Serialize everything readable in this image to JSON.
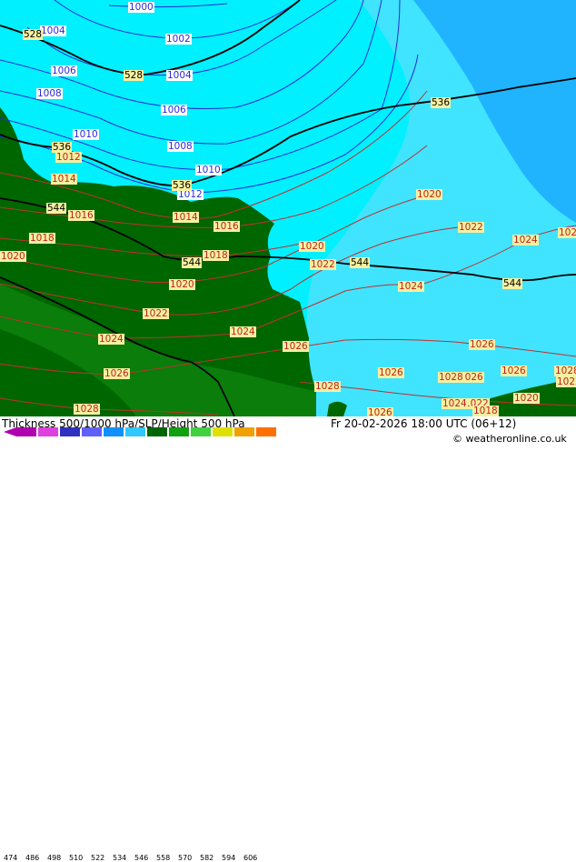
{
  "footer": {
    "title": "Thickness 500/1000 hPa/SLP/Height 500 hPa",
    "valid_time": "Fr 20-02-2026 18:00 UTC (06+12)",
    "copyright": "© weatheronline.co.uk"
  },
  "legend": {
    "values": [
      "474",
      "486",
      "498",
      "510",
      "522",
      "534",
      "546",
      "558",
      "570",
      "582",
      "594",
      "606"
    ],
    "colors": [
      "#b000b0",
      "#e040e0",
      "#3030c0",
      "#6060ff",
      "#1090ff",
      "#30c8ff",
      "#006400",
      "#10a010",
      "#40d040",
      "#e0e000",
      "#f0a000",
      "#ff7000"
    ]
  },
  "map": {
    "colors": {
      "thickness_528_534": "#00f0ff",
      "thickness_534_540": "#40e4ff",
      "thickness_540_546": "#20b4ff",
      "land_546": "#006600",
      "land_552": "#007a00",
      "land_558": "#0a8f0a",
      "slp_low": "#2b2bd8",
      "slp_high": "#c03030",
      "height": "#000000"
    },
    "slp_labels": [
      {
        "text": "1000",
        "kind": "blue"
      },
      {
        "text": "1002",
        "kind": "blue"
      },
      {
        "text": "1004",
        "kind": "blue"
      },
      {
        "text": "1004",
        "kind": "blue"
      },
      {
        "text": "1006",
        "kind": "blue"
      },
      {
        "text": "1006",
        "kind": "blue"
      },
      {
        "text": "1008",
        "kind": "blue"
      },
      {
        "text": "1008",
        "kind": "blue"
      },
      {
        "text": "1010",
        "kind": "blue"
      },
      {
        "text": "1010",
        "kind": "blue"
      },
      {
        "text": "1012",
        "kind": "blue"
      },
      {
        "text": "1012",
        "kind": "red"
      },
      {
        "text": "1014",
        "kind": "red"
      },
      {
        "text": "1014",
        "kind": "red"
      },
      {
        "text": "1016",
        "kind": "red"
      },
      {
        "text": "1016",
        "kind": "red"
      },
      {
        "text": "1018",
        "kind": "red"
      },
      {
        "text": "1018",
        "kind": "red"
      },
      {
        "text": "1020",
        "kind": "red"
      },
      {
        "text": "1020",
        "kind": "red"
      },
      {
        "text": "1020",
        "kind": "red"
      },
      {
        "text": "1020",
        "kind": "red"
      },
      {
        "text": "1020",
        "kind": "red"
      },
      {
        "text": "1022",
        "kind": "red"
      },
      {
        "text": "1022",
        "kind": "red"
      },
      {
        "text": "1022",
        "kind": "red"
      },
      {
        "text": "1022",
        "kind": "red"
      },
      {
        "text": "1024",
        "kind": "red"
      },
      {
        "text": "1024",
        "kind": "red"
      },
      {
        "text": "1024",
        "kind": "red"
      },
      {
        "text": "1024",
        "kind": "red"
      },
      {
        "text": "1024",
        "kind": "red"
      },
      {
        "text": "1026",
        "kind": "red"
      },
      {
        "text": "1026",
        "kind": "red"
      },
      {
        "text": "1026",
        "kind": "red"
      },
      {
        "text": "1026",
        "kind": "red"
      },
      {
        "text": "1026",
        "kind": "red"
      },
      {
        "text": "1026",
        "kind": "red"
      },
      {
        "text": "1026",
        "kind": "red"
      },
      {
        "text": "1028",
        "kind": "red"
      },
      {
        "text": "1028",
        "kind": "red"
      },
      {
        "text": "1028",
        "kind": "red"
      },
      {
        "text": "1028",
        "kind": "red"
      },
      {
        "text": "102",
        "kind": "red"
      },
      {
        "text": "1022",
        "kind": "red"
      },
      {
        "text": "1018",
        "kind": "red"
      }
    ],
    "height_labels": [
      "528",
      "528",
      "536",
      "536",
      "536",
      "544",
      "544",
      "544",
      "544"
    ]
  }
}
